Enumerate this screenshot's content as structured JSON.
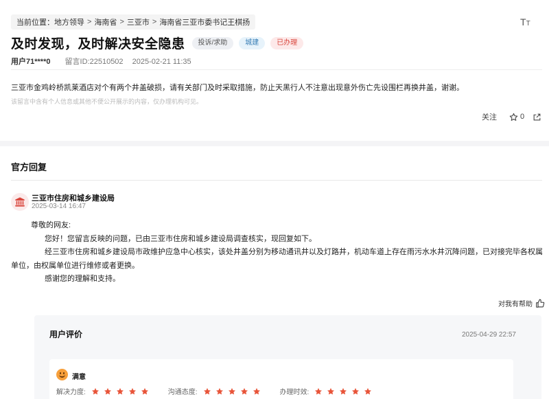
{
  "breadcrumb": {
    "prefix": "当前位置：",
    "items": [
      "地方领导",
      "海南省",
      "三亚市",
      "海南省三亚市委书记王棋扬"
    ],
    "separator": ">"
  },
  "font_toggle": {
    "big": "T",
    "small": "T"
  },
  "message": {
    "title": "及时发现，及时解决安全隐患",
    "tags": [
      "投诉/求助",
      "城建",
      "已办理"
    ],
    "user": "用户71****0",
    "id_label": "留言ID:22510502",
    "date": "2025-02-21 11:35",
    "content": "三亚市金鸡岭桥凯莱酒店对个有两个井盖破损，请有关部门及时采取措施，防止天黑行人不注意出现意外伤亡先设围栏再换井盖，谢谢。",
    "note": "该留言中含有个人信息或其他不便公开展示的内容，仅办理机构可见。",
    "follow_label": "关注",
    "star_count": "0"
  },
  "reply": {
    "heading": "官方回复",
    "department": "三亚市住房和城乡建设局",
    "time": "2025-03-14 16:47",
    "greeting": "尊敬的网友:",
    "paragraphs": [
      "您好！您留言反映的问题，已由三亚市住房和城乡建设局调查核实，现回复如下。",
      "经三亚市住房和城乡建设局市政维护应急中心核实，该处井盖分别为移动通讯井以及灯路井，机动车道上存在雨污水水井沉降问题，已对接完毕各权属单位，由权属单位进行维修或者更换。",
      "感谢您的理解和支持。"
    ],
    "helpful_label": "对我有帮助"
  },
  "evaluation": {
    "title": "用户评价",
    "time": "2025-04-29 22:57",
    "overall": "满意",
    "ratings": [
      {
        "label": "解决力度:",
        "stars": 5
      },
      {
        "label": "沟通态度:",
        "stars": 5
      },
      {
        "label": "办理时效:",
        "stars": 5
      }
    ]
  },
  "colors": {
    "star": "#e8553a",
    "tag_red": "#d9463d",
    "tag_blue": "#3a7fb6",
    "dept_icon": "#d9463d"
  }
}
